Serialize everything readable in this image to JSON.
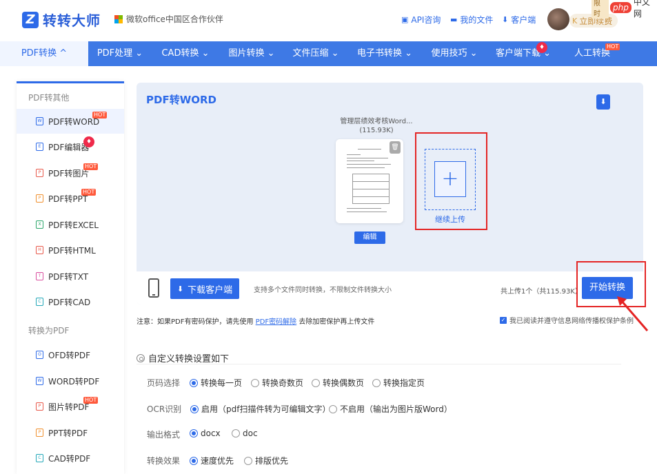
{
  "brand": {
    "name": "转转大师",
    "logo_letter": "Z"
  },
  "partner": "微软office中国区合作伙伴",
  "toplinks": [
    {
      "icon": "chat-icon",
      "label": "API咨询"
    },
    {
      "icon": "folder-icon",
      "label": "我的文件"
    },
    {
      "icon": "download-icon",
      "label": "客户端"
    }
  ],
  "vip": {
    "label": "立即续费",
    "limited": "限时"
  },
  "watermark": {
    "php": "php",
    "cn": "中文网"
  },
  "nav": [
    {
      "label": "PDF转换 ^",
      "active": true
    },
    {
      "label": "PDF处理 ⌄"
    },
    {
      "label": "CAD转换 ⌄"
    },
    {
      "label": "图片转换 ⌄"
    },
    {
      "label": "文件压缩 ⌄"
    },
    {
      "label": "电子书转换 ⌄"
    },
    {
      "label": "使用技巧 ⌄"
    },
    {
      "label": "客户端下载 ⌄",
      "fire": true
    },
    {
      "label": "人工转换",
      "hot": "HOT"
    }
  ],
  "sidebar": {
    "cat1": "PDF转其他",
    "cat2": "转换为PDF",
    "items1": [
      {
        "label": "PDF转WORD",
        "badge": "HOT",
        "color": "#2d6ae8"
      },
      {
        "label": "PDF编辑器",
        "fire": true,
        "color": "#2d6ae8"
      },
      {
        "label": "PDF转图片",
        "badge": "HOT",
        "color": "#e8584a"
      },
      {
        "label": "PDF转PPT",
        "badge": "HOT",
        "color": "#f0902e"
      },
      {
        "label": "PDF转EXCEL",
        "color": "#2aa56a"
      },
      {
        "label": "PDF转HTML",
        "color": "#e8584a"
      },
      {
        "label": "PDF转TXT",
        "color": "#d94fa0"
      },
      {
        "label": "PDF转CAD",
        "color": "#22a7b8"
      }
    ],
    "items2": [
      {
        "label": "OFD转PDF",
        "color": "#2d6ae8"
      },
      {
        "label": "WORD转PDF",
        "color": "#2d6ae8"
      },
      {
        "label": "图片转PDF",
        "badge": "HOT",
        "color": "#e8584a"
      },
      {
        "label": "PPT转PDF",
        "color": "#f0902e"
      },
      {
        "label": "CAD转PDF",
        "color": "#22a7b8"
      }
    ]
  },
  "panel": {
    "title": "PDF转WORD",
    "file_name": "管理层绩效考核Word...",
    "file_size": "(115.93K)",
    "edit": "编辑",
    "continue_upload": "继续上传",
    "download_client": "下载客户端",
    "support_text": "支持多个文件同时转换，不限制文件转换大小",
    "total_text": "共上传1个（共115.93K）",
    "start": "开始转换"
  },
  "notice": {
    "prefix": "注意：如果PDF有密码保护，请先使用",
    "link": "PDF密码解除",
    "suffix": "去除加密保护再上传文件",
    "agree": "我已阅读并遵守信息网络传播权保护条例"
  },
  "settings": {
    "title": "自定义转换设置如下",
    "rows": [
      {
        "label": "页码选择",
        "options": [
          "转换每一页",
          "转换奇数页",
          "转换偶数页",
          "转换指定页"
        ],
        "selected": 0
      },
      {
        "label": "OCR识别",
        "options": [
          "启用（pdf扫描件转为可编辑文字）",
          "不启用（输出为图片版Word）"
        ],
        "selected": 0
      },
      {
        "label": "输出格式",
        "options": [
          "docx",
          "doc"
        ],
        "selected": 0
      },
      {
        "label": "转换效果",
        "options": [
          "速度优先",
          "排版优先"
        ],
        "selected": 0
      }
    ]
  },
  "colors": {
    "accent": "#2d6ae8",
    "nav": "#3e79e5",
    "highlight": "#e42424"
  }
}
